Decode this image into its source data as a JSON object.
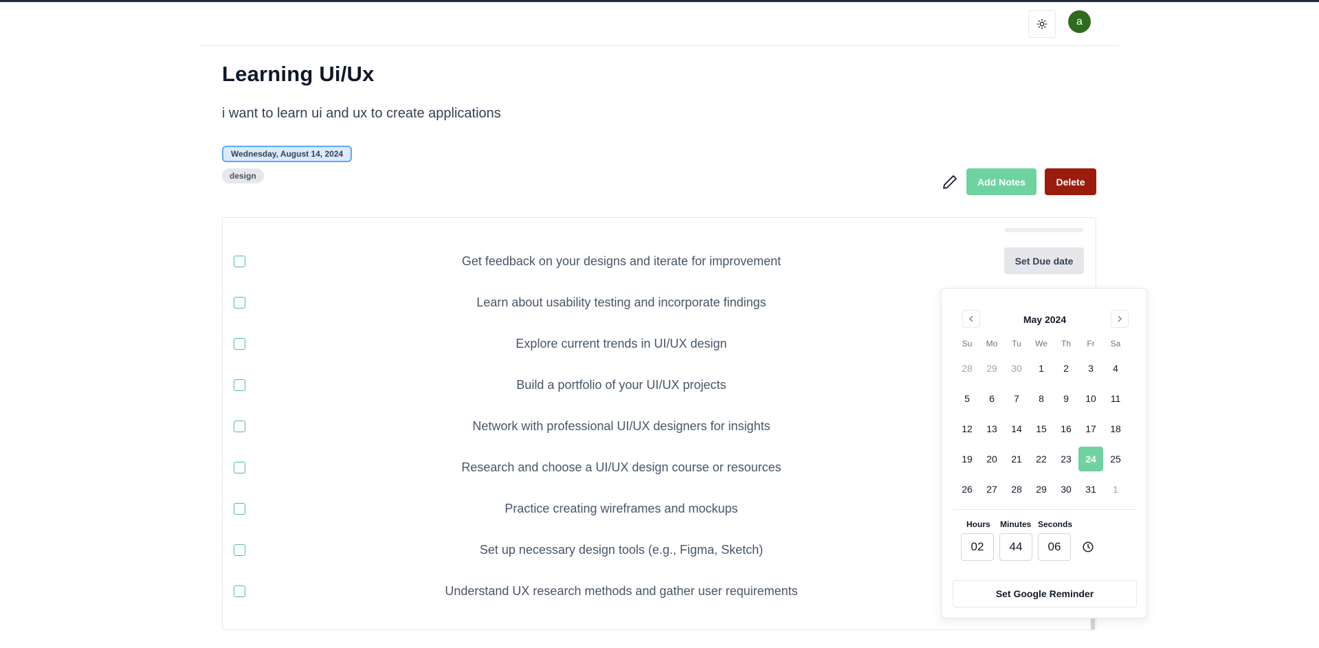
{
  "header": {
    "avatar_initial": "a",
    "theme_icon": "sun-icon"
  },
  "page": {
    "title": "Learning Ui/Ux",
    "description": "i want to learn ui and ux to create applications",
    "date": "Wednesday, August 14, 2024",
    "tag": "design"
  },
  "actions": {
    "edit_icon": "pencil-icon",
    "add_notes": "Add Notes",
    "delete": "Delete"
  },
  "tasks": [
    {
      "text": "Get feedback on your designs and iterate for improvement",
      "due_label": "Set Due date",
      "checked": false
    },
    {
      "text": "Learn about usability testing and incorporate findings",
      "checked": false
    },
    {
      "text": "Explore current trends in UI/UX design",
      "checked": false
    },
    {
      "text": "Build a portfolio of your UI/UX projects",
      "checked": false
    },
    {
      "text": "Network with professional UI/UX designers for insights",
      "checked": false
    },
    {
      "text": "Research and choose a UI/UX design course or resources",
      "checked": false
    },
    {
      "text": "Practice creating wireframes and mockups",
      "checked": false
    },
    {
      "text": "Set up necessary design tools (e.g., Figma, Sketch)",
      "checked": false
    },
    {
      "text": "Understand UX research methods and gather user requirements",
      "checked": false
    }
  ],
  "datepicker": {
    "month_label": "May 2024",
    "weekdays": [
      "Su",
      "Mo",
      "Tu",
      "We",
      "Th",
      "Fr",
      "Sa"
    ],
    "weeks": [
      [
        "28",
        "29",
        "30",
        "1",
        "2",
        "3",
        "4"
      ],
      [
        "5",
        "6",
        "7",
        "8",
        "9",
        "10",
        "11"
      ],
      [
        "12",
        "13",
        "14",
        "15",
        "16",
        "17",
        "18"
      ],
      [
        "19",
        "20",
        "21",
        "22",
        "23",
        "24",
        "25"
      ],
      [
        "26",
        "27",
        "28",
        "29",
        "30",
        "31",
        "1"
      ]
    ],
    "outside_month": [
      [
        0,
        0
      ],
      [
        0,
        1
      ],
      [
        0,
        2
      ],
      [
        4,
        6
      ]
    ],
    "selected": [
      3,
      5
    ],
    "time": {
      "hours_label": "Hours",
      "minutes_label": "Minutes",
      "seconds_label": "Seconds",
      "hours": "02",
      "minutes": "44",
      "seconds": "06"
    },
    "reminder_button": "Set Google Reminder"
  },
  "colors": {
    "accent_green": "#6ed3a0",
    "delete_red": "#9b1c0c",
    "avatar_green": "#2e6b1f",
    "date_badge_border": "#60a5fa"
  }
}
